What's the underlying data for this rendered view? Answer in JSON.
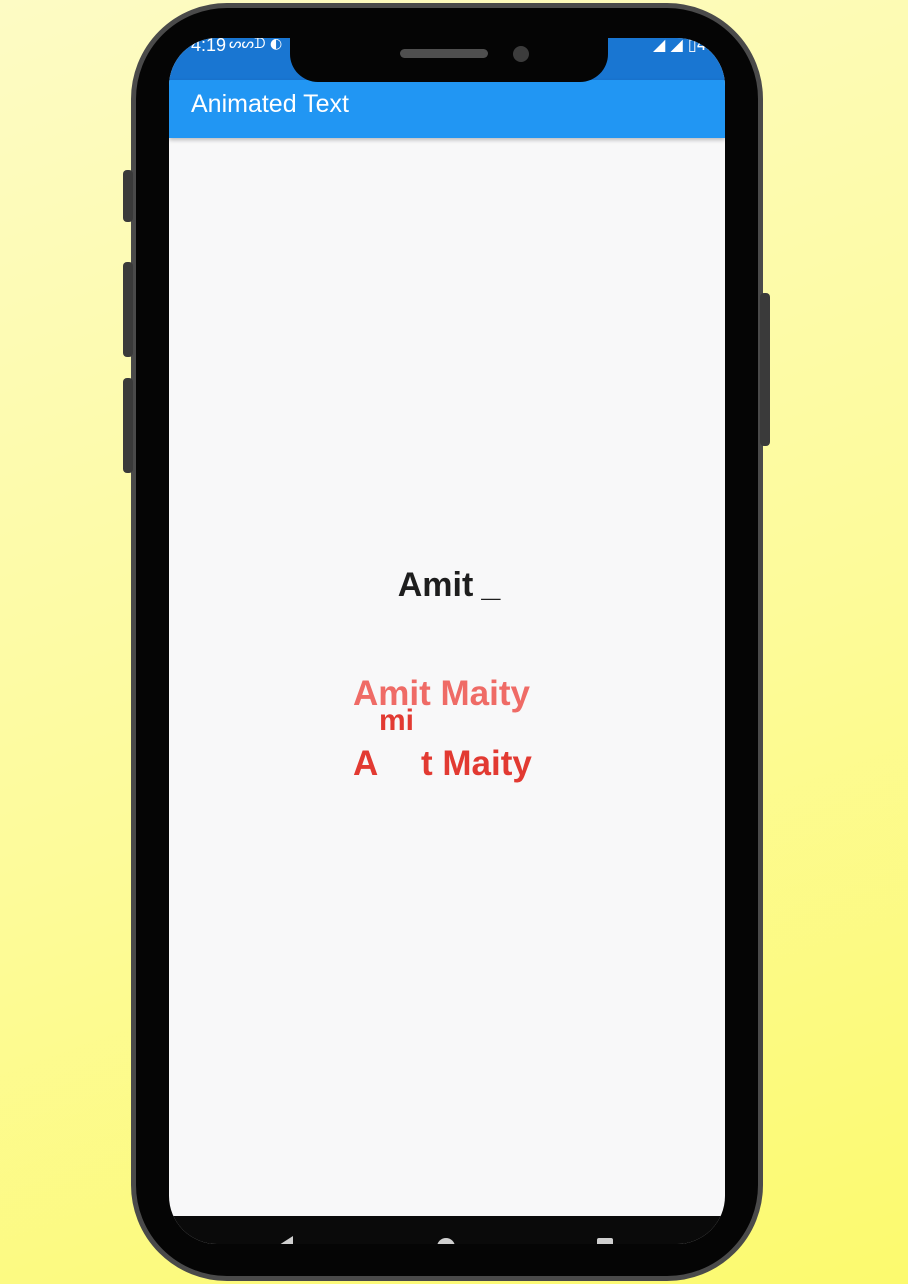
{
  "status_bar": {
    "time": "4:19",
    "left_icons": "ᔕᔕᗪ ◐",
    "right_icons": "◢ ◢ ▯42"
  },
  "app_bar": {
    "title": "Animated Text"
  },
  "content": {
    "typewriter_text": "Amit",
    "typewriter_cursor": "_",
    "animated_rows": {
      "faded_full": "Amit Maity",
      "falling_letters": "mi",
      "solid_prefix": "A",
      "solid_suffix": "t Maity"
    }
  },
  "nav_bar": {
    "back_icon": "back-triangle",
    "home_icon": "home-circle",
    "recents_icon": "recents-square"
  },
  "colors": {
    "background": "#fdfb9a",
    "app_bar": "#2196f3",
    "status_bar": "#1976d2",
    "screen_bg": "#f8f8f9",
    "typewriter_text": "#1e1e1e",
    "faded_red": "#ef6b66",
    "solid_red": "#e23a32"
  }
}
